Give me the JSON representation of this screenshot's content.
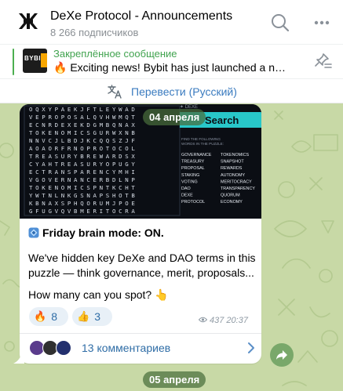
{
  "header": {
    "title": "DeXe Protocol - Announcements",
    "subscribers": "8 266 подписчиков"
  },
  "pinned": {
    "label": "Закреплённое сообщение",
    "text": "🔥 Exciting news! Bybit has just launched a new Per...",
    "thumb_text": "BYBIT"
  },
  "translate": {
    "label": "Перевести (Русский)"
  },
  "post": {
    "date_top": "04 апреля",
    "puzzle": {
      "heading": "Search",
      "subheading": "FIND THE FOLLOWING WORDS IN THE PUZZLE:",
      "words_left": [
        "GOVERNANCE",
        "TREASURY",
        "PROPOSAL",
        "STAKING",
        "VOTING",
        "DAO",
        "DEXE",
        "PROTOCOL"
      ],
      "words_right": [
        "TOKENOMICS",
        "SNAPSHOT",
        "REWARDS",
        "AUTONOMY",
        "MERITOCRACY",
        "TRANSPARENCY",
        "QUORUM",
        "ECONOMY"
      ],
      "grid": [
        "OQXYPAEKJFTLEYWAD",
        "VEPROPOSALQVHWMQT",
        "ECNRDEXEKDGMBQNAX",
        "TOKENOMICSGURWXNB",
        "NNVCJLBDJKCQQSZJF",
        "AOAORFRNOPROTOCOL",
        "TREASURYBREWARDSX",
        "CYAHTREASURYOPUGY",
        "ECTRANSPARENCYMHI",
        "VGOVERNANCERBDLNP",
        "TOKENOMICSPNTKCHT",
        "YWTNLNKGSNAPSHOTB",
        "KBNAXSPHQORUMJPOE",
        "GFUGVQVBMERITOCRA"
      ]
    },
    "title": "Friday brain mode: ON.",
    "body_lines": [
      "We've hidden key DeXe and DAO terms in this",
      "puzzle — think governance, merit, proposals..."
    ],
    "question": "How many can you spot? 👆",
    "reactions": [
      {
        "emoji": "🔥",
        "count": "8"
      },
      {
        "emoji": "👍",
        "count": "3"
      }
    ],
    "views": "437",
    "time": "20:37",
    "comments_label": "13 комментариев"
  },
  "date_bottom": "05 апреля",
  "colors": {
    "accent_green": "#41a34f",
    "link_blue": "#2f6da6",
    "chat_bg": "#c8d9a6",
    "date_pill": "#486e3c"
  }
}
